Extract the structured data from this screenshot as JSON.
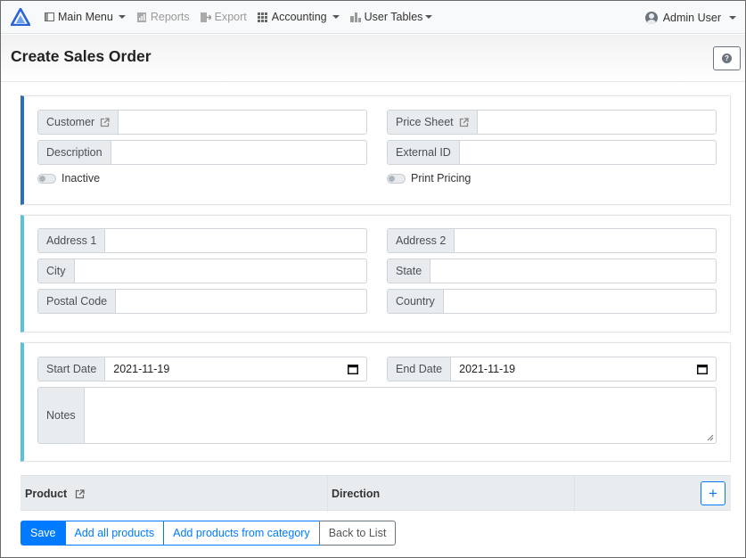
{
  "navbar": {
    "items": [
      {
        "label": "Main Menu",
        "icon": "sidebar-icon",
        "dropdown": true,
        "muted": false
      },
      {
        "label": "Reports",
        "icon": "report-icon",
        "dropdown": false,
        "muted": true
      },
      {
        "label": "Export",
        "icon": "export-icon",
        "dropdown": false,
        "muted": true
      },
      {
        "label": "Accounting",
        "icon": "grid-icon",
        "dropdown": true,
        "muted": false
      },
      {
        "label": "User Tables",
        "icon": "tables-icon",
        "dropdown": true,
        "muted": false
      }
    ],
    "user": {
      "label": "Admin User",
      "icon": "user-avatar-icon"
    }
  },
  "page": {
    "title": "Create Sales Order",
    "help_icon": "question-icon"
  },
  "section1": {
    "customer_label": "Customer",
    "customer_value": "",
    "description_label": "Description",
    "description_value": "",
    "inactive_label": "Inactive",
    "price_sheet_label": "Price Sheet",
    "price_sheet_value": "",
    "external_id_label": "External ID",
    "external_id_value": "",
    "print_pricing_label": "Print Pricing"
  },
  "section2": {
    "address1_label": "Address 1",
    "address2_label": "Address 2",
    "city_label": "City",
    "state_label": "State",
    "postal_code_label": "Postal Code",
    "country_label": "Country"
  },
  "section3": {
    "start_date_label": "Start Date",
    "start_date_value": "2021-11-19",
    "end_date_label": "End Date",
    "end_date_value": "2021-11-19",
    "notes_label": "Notes",
    "notes_value": ""
  },
  "table": {
    "columns": [
      "Product",
      "Direction"
    ],
    "add_label": "+"
  },
  "actions": {
    "save": "Save",
    "add_all": "Add all products",
    "add_from_category": "Add products from category",
    "back": "Back to List"
  },
  "colors": {
    "primary": "#007bff",
    "card_accent_primary": "#2c6fb7",
    "card_accent_info": "#5bc0de",
    "brand": "#2a64d6"
  }
}
